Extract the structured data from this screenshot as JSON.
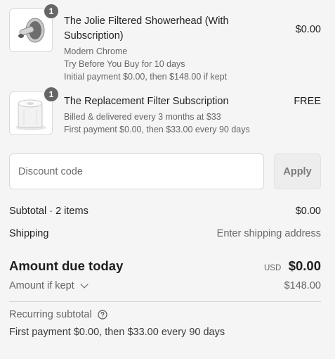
{
  "items": [
    {
      "quantity": "1",
      "title": "The Jolie Filtered Showerhead (With Subscription)",
      "variant": "Modern Chrome",
      "trial": "Try Before You Buy for 10 days",
      "payment_note": "Initial payment $0.00, then $148.00 if kept",
      "price": "$0.00"
    },
    {
      "quantity": "1",
      "title": "The Replacement Filter Subscription",
      "delivery": "Billed & delivered every 3 months at $33",
      "payment_note": "First payment $0.00, then $33.00 every 90 days",
      "price": "FREE"
    }
  ],
  "discount": {
    "placeholder": "Discount code",
    "apply_label": "Apply"
  },
  "summary": {
    "subtotal_label": "Subtotal · 2 items",
    "subtotal_value": "$0.00",
    "shipping_label": "Shipping",
    "shipping_value": "Enter shipping address",
    "due_label": "Amount due today",
    "due_currency": "USD",
    "due_value": "$0.00",
    "kept_label": "Amount if kept",
    "kept_value": "$148.00",
    "recurring_label": "Recurring subtotal",
    "recurring_text": "First payment $0.00, then $33.00 every 90 days"
  },
  "icons": {
    "quantity_badge": "count-badge",
    "kept_toggle": "chevron-down-icon",
    "recurring_help": "question-circle-icon"
  }
}
